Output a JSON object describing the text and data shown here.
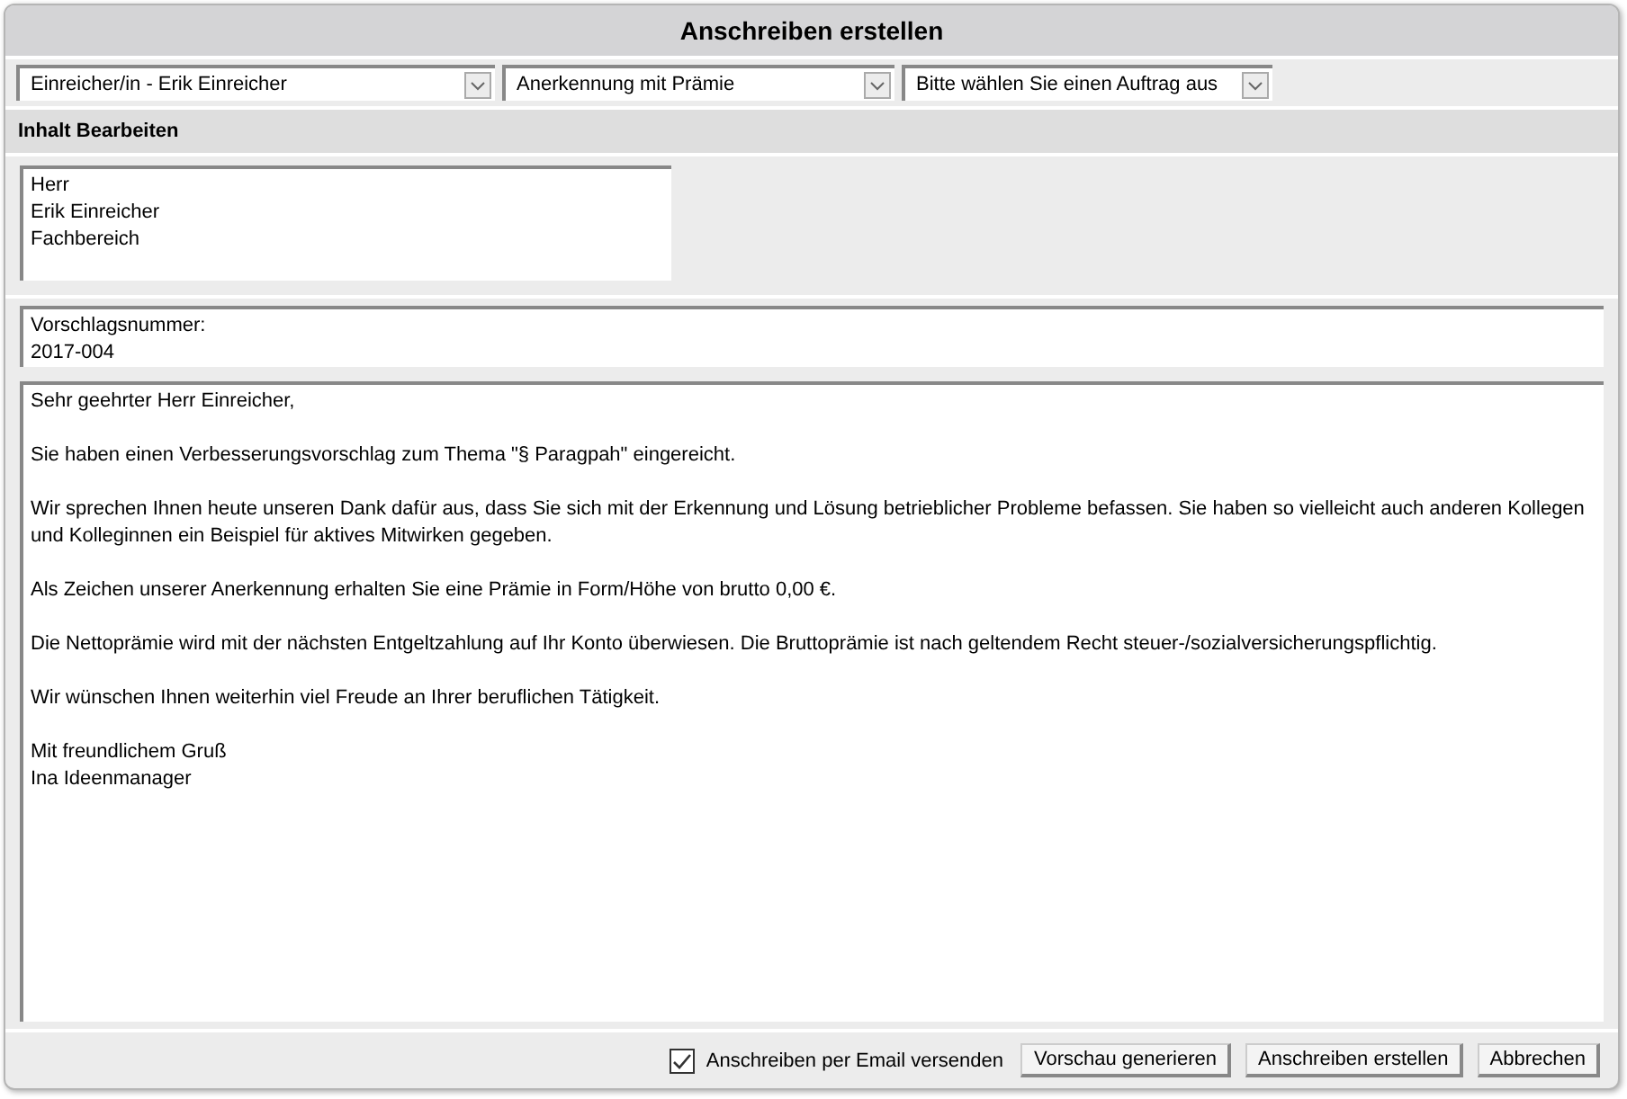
{
  "window": {
    "title": "Anschreiben erstellen"
  },
  "dropdowns": [
    {
      "value": "Einreicher/in - Erik Einreicher"
    },
    {
      "value": "Anerkennung mit Prämie"
    },
    {
      "value": "Bitte wählen Sie einen Auftrag aus"
    }
  ],
  "section": {
    "title": "Inhalt Bearbeiten"
  },
  "address": {
    "lines": [
      "Herr",
      "Erik Einreicher",
      "Fachbereich"
    ]
  },
  "proposal": {
    "lines": [
      "Vorschlagsnummer:",
      "2017-004"
    ]
  },
  "letter": {
    "paragraphs": [
      [
        "Sehr geehrter Herr Einreicher,"
      ],
      [
        "Sie haben einen Verbesserungsvorschlag zum Thema \"§ Paragpah\" eingereicht."
      ],
      [
        "Wir sprechen Ihnen heute unseren Dank dafür aus, dass Sie sich mit der Erkennung und Lösung betrieblicher Probleme befassen. Sie haben so vielleicht auch anderen Kollegen und Kolleginnen ein Beispiel für aktives Mitwirken gegeben."
      ],
      [
        "Als Zeichen unserer Anerkennung erhalten Sie eine Prämie in Form/Höhe von brutto 0,00 €."
      ],
      [
        "Die Nettoprämie wird mit der nächsten Entgeltzahlung auf Ihr Konto überwiesen. Die Bruttoprämie ist nach geltendem Recht steuer-/sozialversicherungspflichtig."
      ],
      [
        "Wir wünschen Ihnen weiterhin viel Freude an Ihrer beruflichen Tätigkeit."
      ],
      [
        "Mit freundlichem Gruß",
        "Ina Ideenmanager"
      ]
    ]
  },
  "email_option": {
    "label": "Anschreiben per Email versenden",
    "checked": true
  },
  "buttons": [
    "Vorschau generieren",
    "Anschreiben erstellen",
    "Abbrechen"
  ]
}
